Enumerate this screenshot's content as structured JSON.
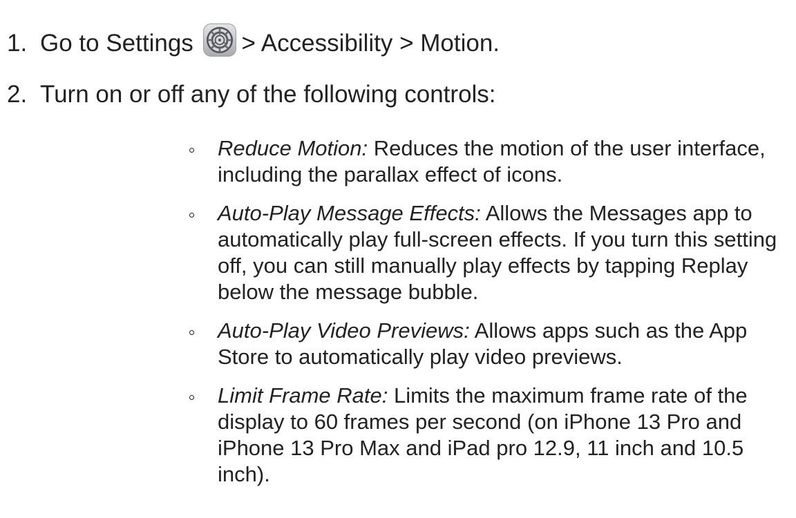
{
  "steps": [
    {
      "number": "1.",
      "before_icon": "Go to Settings",
      "icon": "settings-gear-icon",
      "after_icon": "> Accessibility > Motion."
    },
    {
      "number": "2.",
      "text": "Turn on or off any of the following controls:"
    }
  ],
  "controls": [
    {
      "term": "Reduce Motion:",
      "description": "Reduces the motion of the user interface, including the parallax effect of icons."
    },
    {
      "term": "Auto-Play Message Effects:",
      "description": "Allows the Messages app to automatically play full-screen effects. If you turn this setting off, you can still manually play effects by tapping Replay below the message bubble."
    },
    {
      "term": "Auto-Play Video Previews:",
      "description": "Allows apps such as the App Store to automatically play video previews."
    },
    {
      "term": "Limit Frame Rate:",
      "description": "Limits the maximum frame rate of the display to 60 frames per second (on iPhone 13 Pro and iPhone 13 Pro Max and iPad pro 12.9, 11 inch and 10.5 inch)."
    }
  ],
  "colors": {
    "text": "#222222",
    "icon_background": "#c7c8cc",
    "icon_gear": "#5b5d63"
  }
}
